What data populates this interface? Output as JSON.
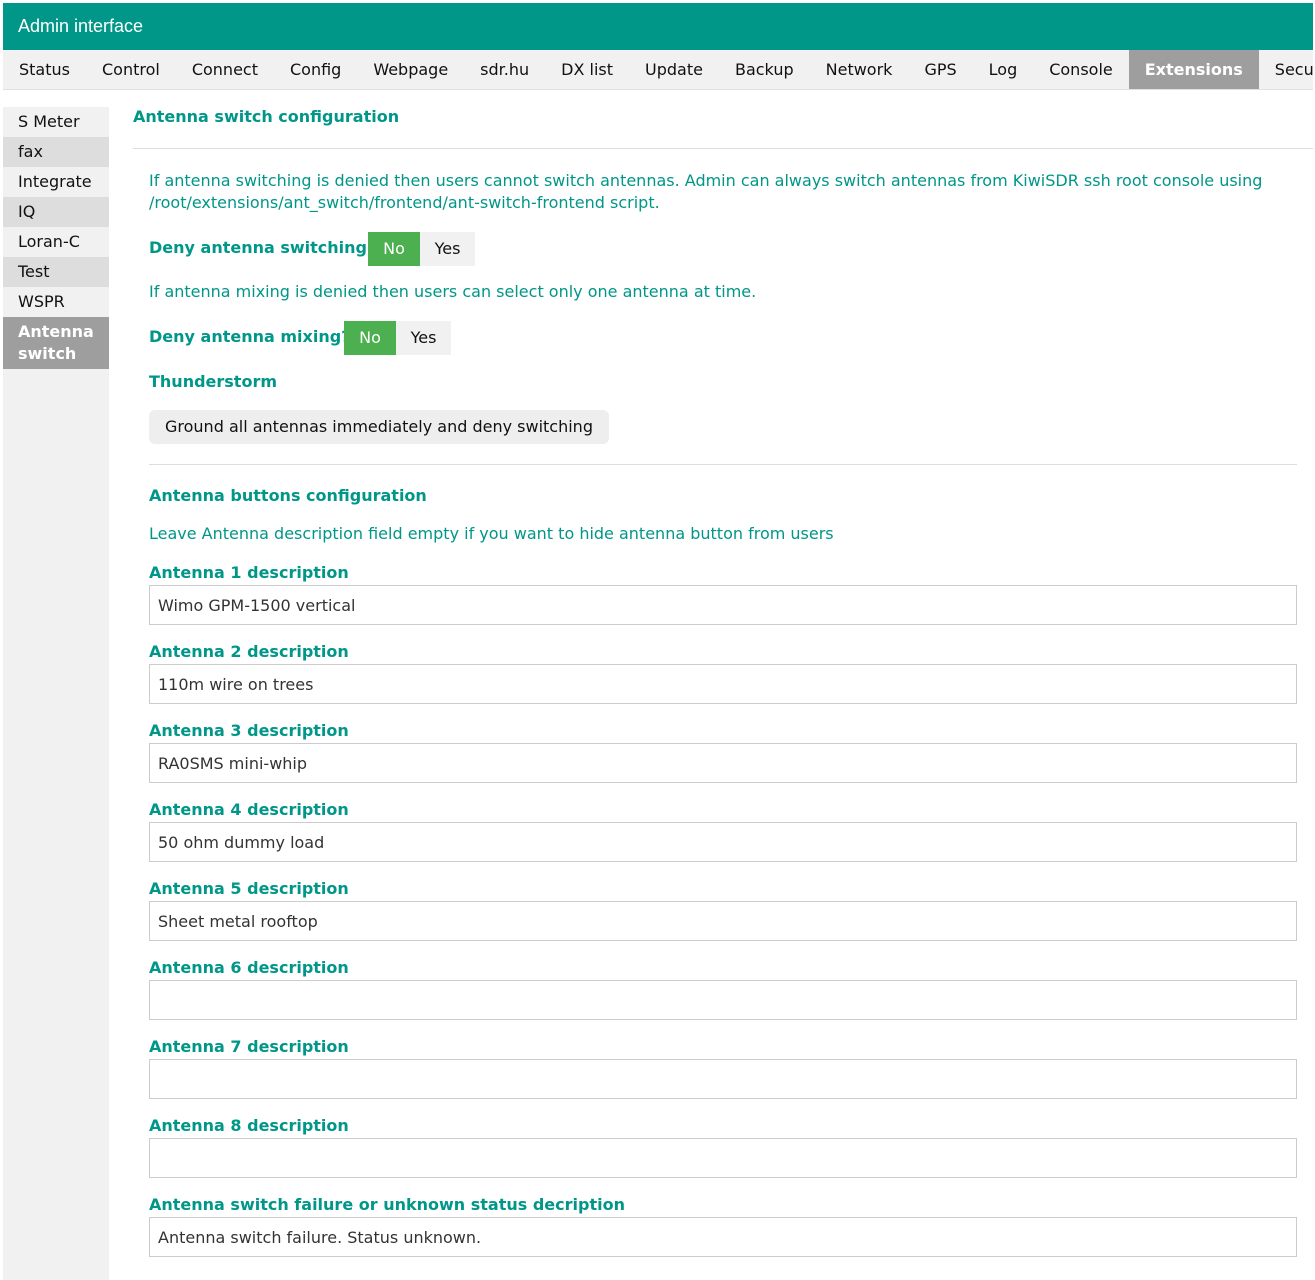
{
  "titlebar": {
    "title": "Admin interface"
  },
  "topnav": {
    "tabs": [
      "Status",
      "Control",
      "Connect",
      "Config",
      "Webpage",
      "sdr.hu",
      "DX list",
      "Update",
      "Backup",
      "Network",
      "GPS",
      "Log",
      "Console",
      "Extensions",
      "Security"
    ],
    "active": "Extensions"
  },
  "sidenav": {
    "items": [
      "S Meter",
      "fax",
      "Integrate",
      "IQ",
      "Loran-C",
      "Test",
      "WSPR",
      "Antenna switch"
    ],
    "active": "Antenna switch"
  },
  "main": {
    "section_title": "Antenna switch configuration",
    "switching_note": "If antenna switching is denied then users cannot switch antennas. Admin can always switch antennas from KiwiSDR ssh root console using /root/extensions/ant_switch/frontend/ant-switch-frontend script.",
    "deny_switching": {
      "label": "Deny antenna switching?",
      "options": [
        "No",
        "Yes"
      ],
      "selected": "No"
    },
    "mixing_note": "If antenna mixing is denied then users can select only one antenna at time.",
    "deny_mixing": {
      "label": "Deny antenna mixing?",
      "options": [
        "No",
        "Yes"
      ],
      "selected": "No"
    },
    "thunderstorm": {
      "title": "Thunderstorm",
      "button_label": "Ground all antennas immediately and deny switching"
    },
    "buttons_config": {
      "title": "Antenna buttons configuration",
      "note": "Leave Antenna description field empty if you want to hide antenna button from users"
    },
    "antennas": [
      {
        "label": "Antenna 1 description",
        "value": "Wimo GPM-1500 vertical"
      },
      {
        "label": "Antenna 2 description",
        "value": "110m wire on trees"
      },
      {
        "label": "Antenna 3 description",
        "value": "RA0SMS mini-whip"
      },
      {
        "label": "Antenna 4 description",
        "value": "50 ohm dummy load"
      },
      {
        "label": "Antenna 5 description",
        "value": "Sheet metal rooftop"
      },
      {
        "label": "Antenna 6 description",
        "value": ""
      },
      {
        "label": "Antenna 7 description",
        "value": ""
      },
      {
        "label": "Antenna 8 description",
        "value": ""
      }
    ],
    "failure": {
      "label": "Antenna switch failure or unknown status decription",
      "value": "Antenna switch failure. Status unknown."
    }
  },
  "colors": {
    "accent": "#009688",
    "toggle_on": "#4caf50",
    "active_tab": "#9e9e9e"
  }
}
